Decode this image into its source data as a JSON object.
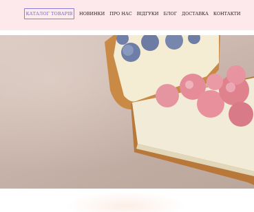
{
  "header": {
    "catalog_button": "КАТАЛОГ ТОВАРІВ",
    "nav": [
      "НОВИНКИ",
      "ПРО НАС",
      "ВІДГУКИ",
      "БЛОГ",
      "ДОСТАВКА",
      "КОНТАКТИ"
    ]
  },
  "colors": {
    "header_bg": "#fde9ec",
    "accent": "#6d5fcf"
  },
  "hero": {
    "image": "cheesecake-with-blueberries-and-raspberries"
  }
}
